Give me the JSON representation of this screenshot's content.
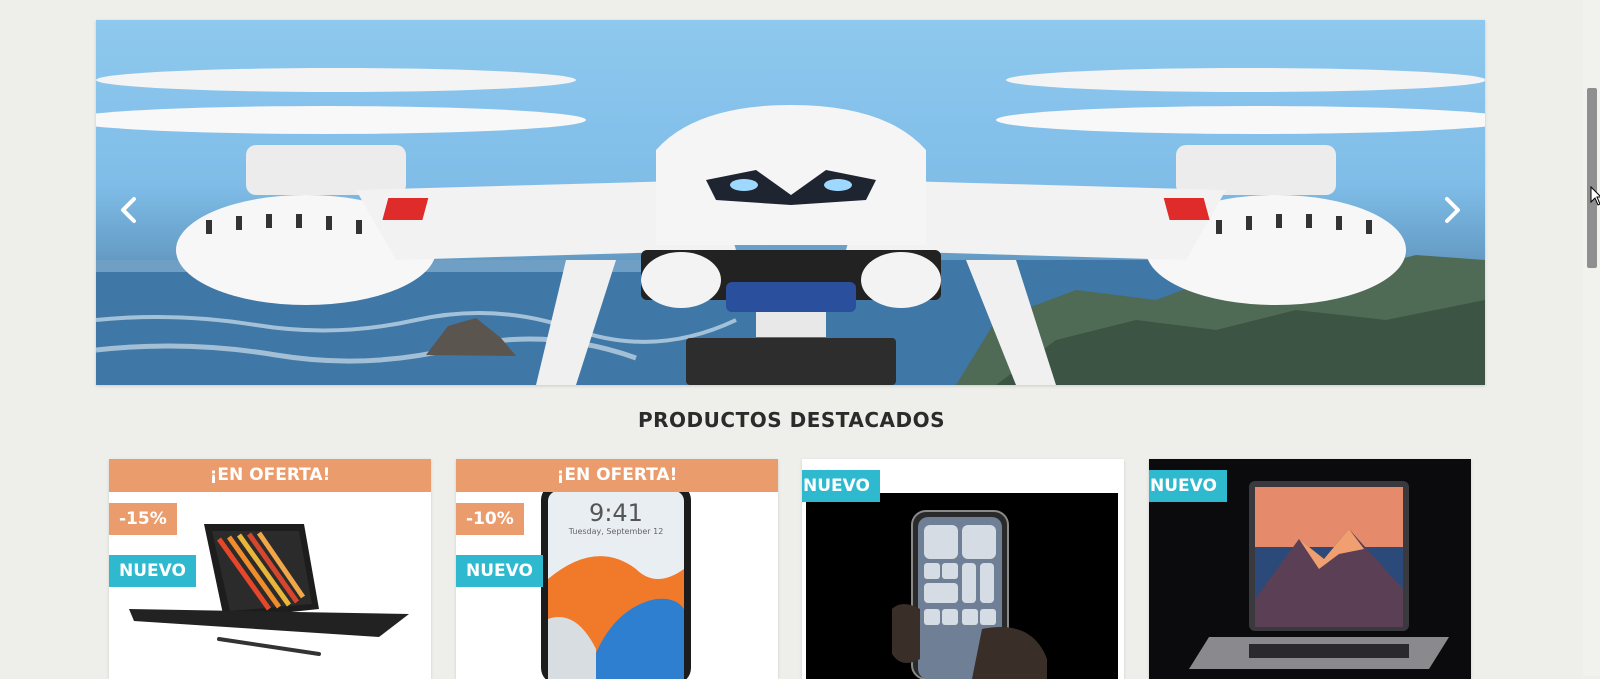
{
  "carousel": {
    "prev_icon": "chevron-left-icon",
    "next_icon": "chevron-right-icon",
    "slide_image": "drone-over-coastline"
  },
  "featured": {
    "title": "PRODUCTOS DESTACADOS",
    "products": [
      {
        "ribbon": "¡EN OFERTA!",
        "discount": "-15%",
        "new_label": "NUEVO",
        "image": "tablet-with-keyboard"
      },
      {
        "ribbon": "¡EN OFERTA!",
        "discount": "-10%",
        "new_label": "NUEVO",
        "image": "smartphone-lockscreen",
        "lock_time": "9:41",
        "lock_date": "Tuesday, September 12"
      },
      {
        "new_label": "NUEVO",
        "image": "phone-in-hand-control-center"
      },
      {
        "new_label": "NUEVO",
        "image": "laptop-mountain-wallpaper"
      }
    ]
  },
  "colors": {
    "offer": "#eb9c6d",
    "new": "#2eb9cf",
    "background": "#eeeeea",
    "title": "#2b2b2b"
  }
}
